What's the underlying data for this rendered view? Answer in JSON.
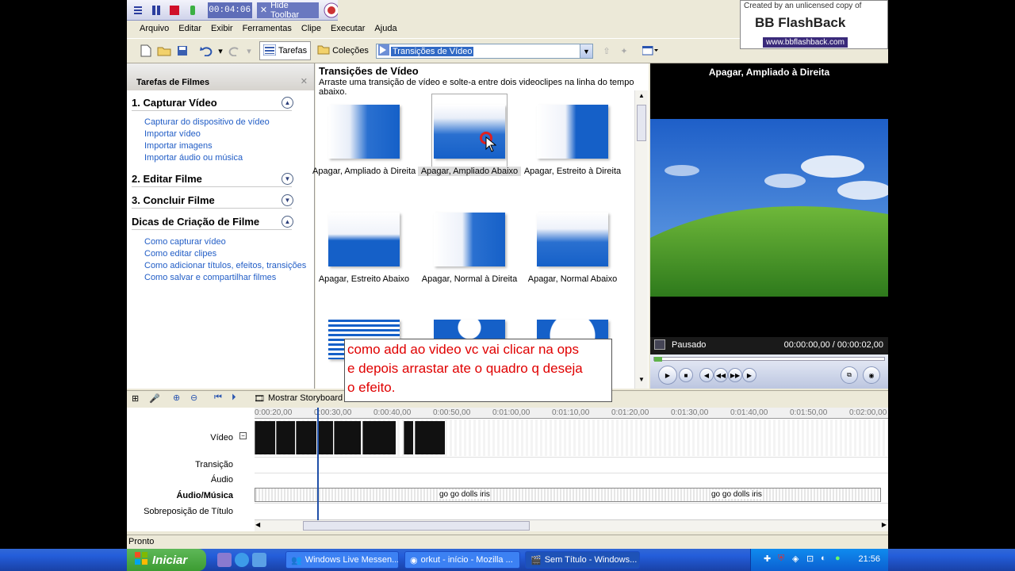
{
  "recorder": {
    "time": "00:04:06",
    "hide_toolbar_label": "Hide Toolbar"
  },
  "watermark": {
    "line1": "Created by an unlicensed copy of",
    "line2": "BB FlashBack",
    "line3": "www.bbflashback.com"
  },
  "menu": [
    "Arquivo",
    "Editar",
    "Exibir",
    "Ferramentas",
    "Clipe",
    "Executar",
    "Ajuda"
  ],
  "toolbar": {
    "tasks_label": "Tarefas",
    "collections_label": "Coleções",
    "collection_select_value": "Transições de Vídeo"
  },
  "taskpane": {
    "title": "Tarefas de Filmes",
    "sections": [
      {
        "title": "1. Capturar Vídeo",
        "links": [
          "Capturar do dispositivo de vídeo",
          "Importar vídeo",
          "Importar imagens",
          "Importar áudio ou música"
        ]
      },
      {
        "title": "2. Editar Filme",
        "links": []
      },
      {
        "title": "3. Concluir Filme",
        "links": []
      },
      {
        "title": "Dicas de Criação de Filme",
        "links": [
          "Como capturar vídeo",
          "Como editar clipes",
          "Como adicionar títulos, efeitos, transições",
          "Como salvar e compartilhar filmes"
        ]
      }
    ]
  },
  "collection": {
    "title": "Transições de Vídeo",
    "description": "Arraste uma transição de vídeo e solte-a entre dois videoclipes na linha do tempo abaixo.",
    "items": [
      {
        "label": "Apagar, Ampliado à Direita"
      },
      {
        "label": "Apagar, Ampliado Abaixo"
      },
      {
        "label": "Apagar, Estreito à Direita"
      },
      {
        "label": "Apagar, Estreito Abaixo"
      },
      {
        "label": "Apagar, Normal à Direita"
      },
      {
        "label": "Apagar, Normal Abaixo"
      }
    ]
  },
  "note": {
    "lines": [
      "como add ao video vc vai clicar na ops",
      "e depois arrastar ate o quadro q deseja",
      "o efeito."
    ]
  },
  "monitor": {
    "title": "Apagar, Ampliado à Direita",
    "status": "Pausado",
    "time": "00:00:00,00 / 00:00:02,00"
  },
  "timeline": {
    "storyboard_label": "Mostrar Storyboard",
    "ruler": [
      "0:00:20,00",
      "0:00:30,00",
      "0:00:40,00",
      "0:00:50,00",
      "0:01:00,00",
      "0:01:10,00",
      "0:01:20,00",
      "0:01:30,00",
      "0:01:40,00",
      "0:01:50,00",
      "0:02:00,00"
    ],
    "tracks": {
      "video": "Vídeo",
      "transition": "Transição",
      "audio": "Áudio",
      "music": "Áudio/Música",
      "title_overlay": "Sobreposição de Título"
    },
    "audio_clips": [
      "go go dolls iris",
      "go go dolls iris"
    ]
  },
  "statusbar": {
    "text": "Pronto"
  },
  "taskbar": {
    "start_label": "Iniciar",
    "tasks": [
      "Windows Live Messen...",
      "orkut - início - Mozilla ...",
      "Sem Título - Windows..."
    ],
    "clock": "21:56"
  }
}
